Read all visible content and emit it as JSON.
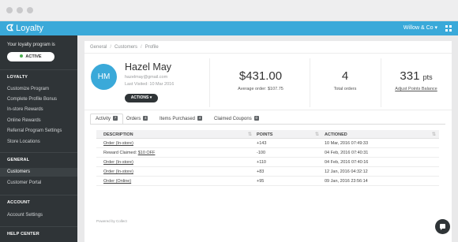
{
  "app": {
    "name": "Loyalty",
    "account": "Willow & Co"
  },
  "sidebar": {
    "program_label": "Your loyalty program is",
    "status": "ACTIVE",
    "sections": [
      {
        "title": "LOYALTY",
        "items": [
          "Customize Program",
          "Complete Profile Bonus",
          "In-store Rewards",
          "Online Rewards",
          "Referral Program Settings",
          "Store Locations"
        ]
      },
      {
        "title": "GENERAL",
        "items": [
          "Customers",
          "Customer Portal"
        ]
      },
      {
        "title": "ACCOUNT",
        "items": [
          "Account Settings"
        ]
      },
      {
        "title": "HELP CENTER",
        "items": []
      }
    ],
    "selected": "Customers"
  },
  "breadcrumb": [
    "General",
    "Customers",
    "Profile"
  ],
  "profile": {
    "initials": "HM",
    "name": "Hazel May",
    "email": "hazelmay@gmail.com",
    "last_visited": "Last Visited: 10 Mar 2016",
    "actions_label": "ACTIONS"
  },
  "stats": {
    "amount": "$431.00",
    "avg_label": "Average order: $107.75",
    "orders": "4",
    "orders_label": "Total orders",
    "points": "331",
    "points_unit": "pts",
    "points_link": "Adjust Points Balance"
  },
  "tabs": [
    {
      "label": "Activity",
      "count": "7"
    },
    {
      "label": "Orders",
      "count": "4"
    },
    {
      "label": "Items Purchased",
      "count": "4"
    },
    {
      "label": "Claimed Coupons",
      "count": "0"
    }
  ],
  "table": {
    "columns": [
      "DESCRIPTION",
      "POINTS",
      "ACTIONED"
    ],
    "rows": [
      {
        "desc": "Order (In-store)",
        "points": "+143",
        "date": "10 Mar, 2016 07:49:33"
      },
      {
        "desc_prefix": "Reward Claimed: ",
        "desc": "$10 OFF",
        "points": "-100",
        "date": "04 Feb, 2016 07:40:31"
      },
      {
        "desc": "Order (In-store)",
        "points": "+110",
        "date": "04 Feb, 2016 07:40:16"
      },
      {
        "desc": "Order (In-store)",
        "points": "+83",
        "date": "12 Jan, 2016 04:32:12"
      },
      {
        "desc": "Order (Online)",
        "points": "+95",
        "date": "09 Jan, 2016 23:56:14"
      }
    ]
  },
  "footer": {
    "powered": "Powered by Collect"
  },
  "colors": {
    "accent": "#3aa9d9",
    "sidebar": "#2f3437",
    "active": "#4caf50"
  }
}
